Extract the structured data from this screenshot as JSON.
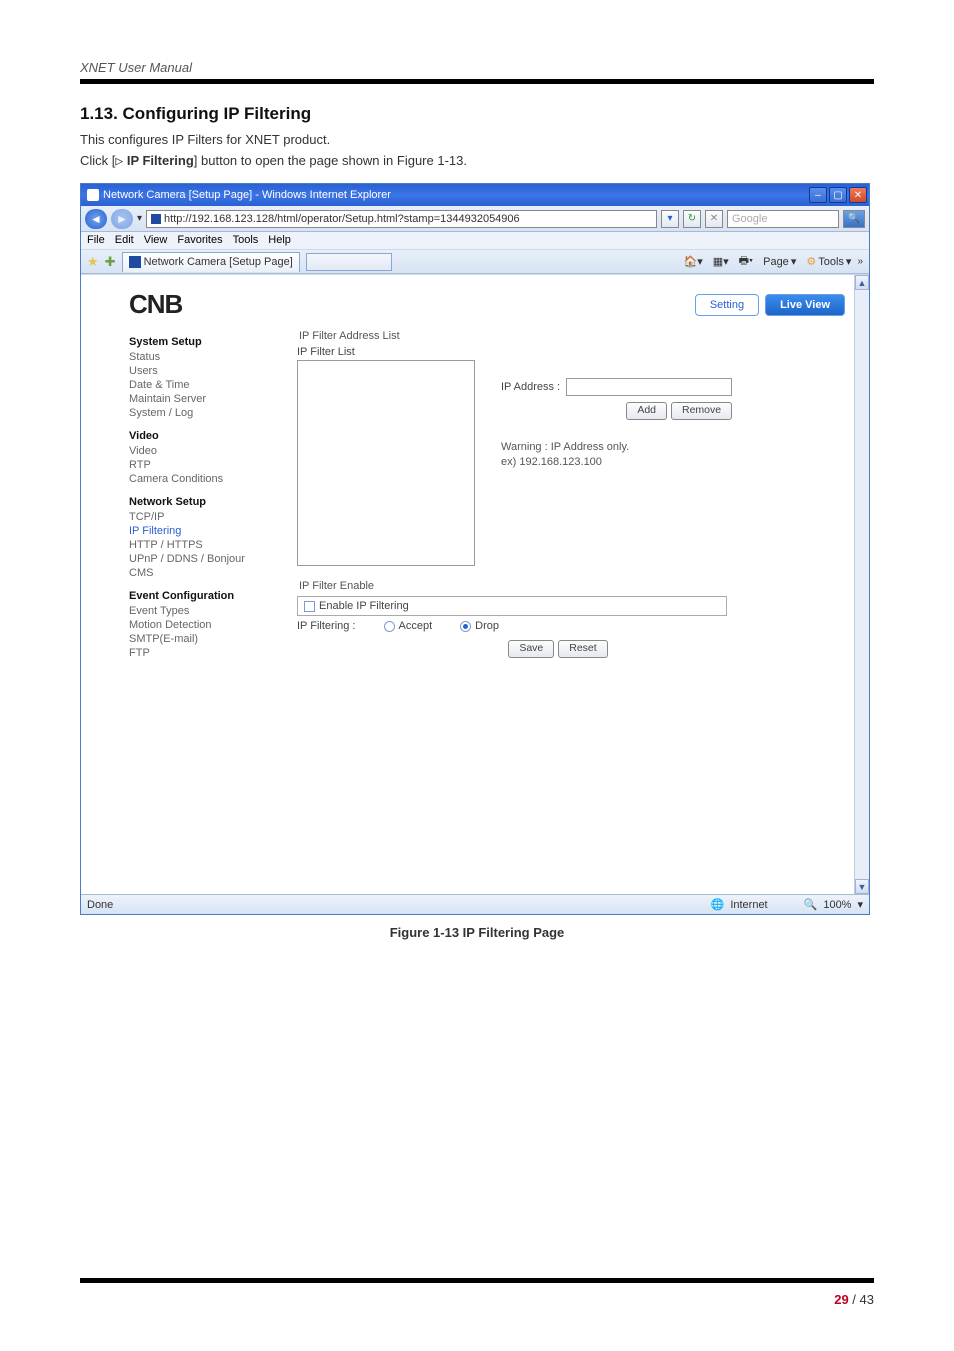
{
  "header": {
    "running": "XNET User Manual"
  },
  "section": {
    "title": "1.13. Configuring IP Filtering",
    "p1": "This configures IP Filters for XNET product.",
    "p2_pre": "Click [",
    "p2_tri": "▷",
    "p2_btn": " IP Filtering",
    "p2_post": "] button to open the page shown in Figure 1-13."
  },
  "browser": {
    "title": "Network Camera [Setup Page] - Windows Internet Explorer",
    "url": "http://192.168.123.128/html/operator/Setup.html?stamp=1344932054906",
    "search_placeholder": "Google",
    "menu": {
      "file": "File",
      "edit": "Edit",
      "view": "View",
      "fav": "Favorites",
      "tools": "Tools",
      "help": "Help"
    },
    "tab": "Network Camera [Setup Page]",
    "tools_right": {
      "page": "Page",
      "tools": "Tools"
    },
    "status_left": "Done",
    "status_zone": "Internet",
    "status_zoom": "100%"
  },
  "brand": {
    "logo": "CNB",
    "setting": "Setting",
    "live": "Live View"
  },
  "sidebar": {
    "h1": "System Setup",
    "g1": {
      "a": "Status",
      "b": "Users",
      "c": "Date & Time",
      "d": "Maintain Server",
      "e": "System / Log"
    },
    "h2": "Video",
    "g2": {
      "a": "Video",
      "b": "RTP",
      "c": "Camera Conditions"
    },
    "h3": "Network Setup",
    "g3": {
      "a": "TCP/IP",
      "b": "IP Filtering",
      "c": "HTTP / HTTPS",
      "d": "UPnP / DDNS / Bonjour",
      "e": "CMS"
    },
    "h4": "Event Configuration",
    "g4": {
      "a": "Event Types",
      "b": "Motion Detection",
      "c": "SMTP(E-mail)",
      "d": "FTP"
    }
  },
  "main": {
    "group1": "IP Filter Address List",
    "listlabel": "IP Filter List",
    "ipaddr": "IP Address :",
    "add": "Add",
    "remove": "Remove",
    "warn1": "Warning : IP Address only.",
    "warn2": "ex) 192.168.123.100",
    "group2": "IP Filter Enable",
    "enable": "Enable IP Filtering",
    "filtlabel": "IP Filtering :",
    "accept": "Accept",
    "drop": "Drop",
    "save": "Save",
    "reset": "Reset"
  },
  "caption": "Figure 1-13 IP Filtering Page",
  "page": {
    "cur": "29",
    "sep": " / ",
    "total": "43"
  },
  "chart_data": {
    "type": "table",
    "title": "IP Filtering Page form state",
    "fields": {
      "IP Filter List": [],
      "IP Address": "",
      "Enable IP Filtering": false,
      "IP Filtering mode": "Drop",
      "IP Filtering options": [
        "Accept",
        "Drop"
      ],
      "Warning": "IP Address only.",
      "Example": "192.168.123.100"
    }
  }
}
